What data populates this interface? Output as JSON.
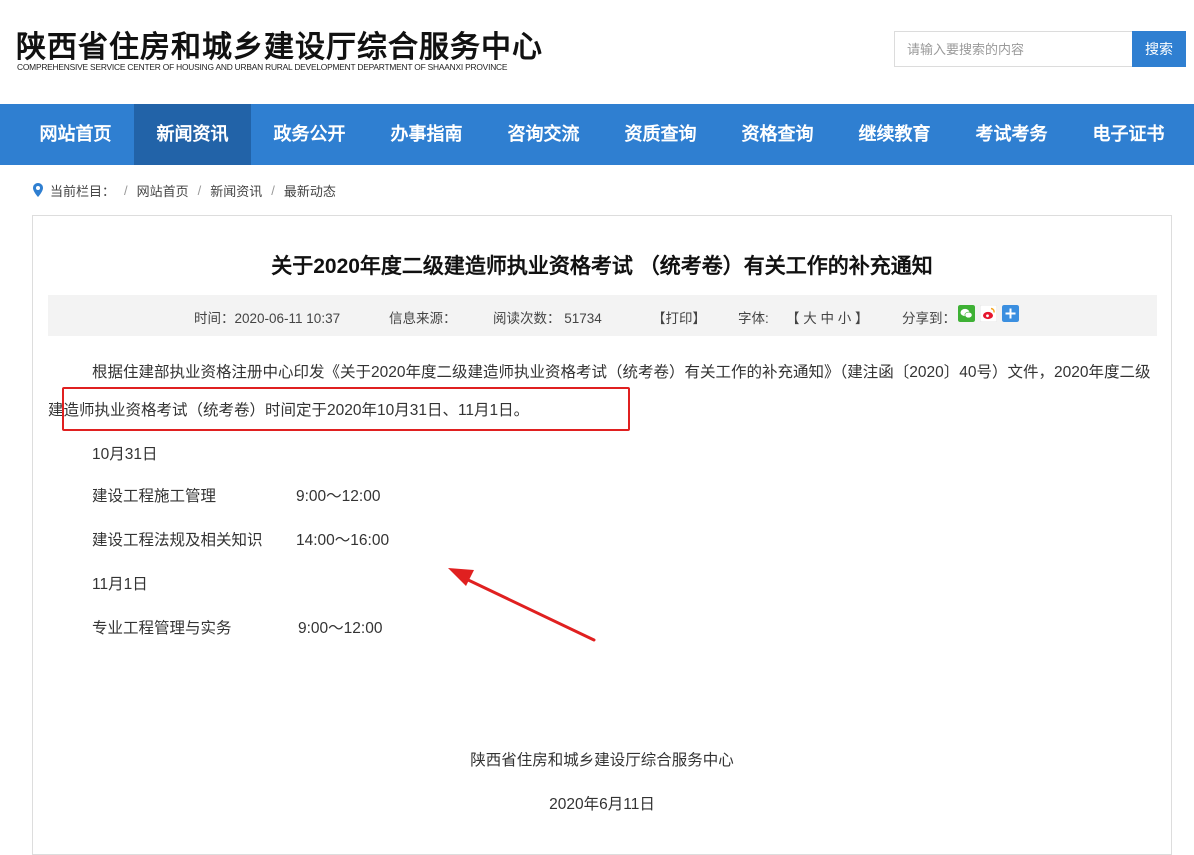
{
  "header": {
    "logo_cn": "陕西省住房和城乡建设厅综合服务中心",
    "logo_en": "COMPREHENSIVE SERVICE CENTER OF HOUSING AND URBAN RURAL DEVELOPMENT DEPARTMENT OF SHAANXI PROVINCE",
    "search_placeholder": "请输入要搜索的内容",
    "search_button": "搜索"
  },
  "nav": {
    "items": [
      "网站首页",
      "新闻资讯",
      "政务公开",
      "办事指南",
      "咨询交流",
      "资质查询",
      "资格查询",
      "继续教育",
      "考试考务",
      "电子证书"
    ],
    "active": "新闻资讯"
  },
  "breadcrumb": {
    "label": "当前栏目：",
    "sep": "/",
    "items": [
      "网站首页",
      "新闻资讯",
      "最新动态"
    ]
  },
  "article": {
    "title": "关于2020年度二级建造师执业资格考试 （统考卷）有关工作的补充通知",
    "meta": {
      "time": "时间：2020-06-11 10:37",
      "source": "信息来源：",
      "reads": "阅读次数： 51734",
      "print": "【打印】",
      "font_label": "字体:",
      "font_sizes": "【 大  中  小 】",
      "share_label": "分享到：",
      "share_icons": [
        "wechat-icon",
        "weibo-icon",
        "more-share-icon"
      ]
    },
    "paragraph": "根据住建部执业资格注册中心印发《关于2020年度二级建造师执业资格考试（统考卷）有关工作的补充通知》（建注函〔2020〕40号）文件，2020年度二级建造师执业资格考试（统考卷）时间定于2020年10月31日、11月1日。",
    "schedule": {
      "day1": "10月31日",
      "day1_items": [
        {
          "subject": "建设工程施工管理",
          "time": "9:00～12:00"
        },
        {
          "subject": "建设工程法规及相关知识",
          "time": "14:00～16:00"
        }
      ],
      "day2": "11月1日",
      "day2_items": [
        {
          "subject": "专业工程管理与实务",
          "time": "9:00～12:00"
        }
      ]
    },
    "signature": "陕西省住房和城乡建设厅综合服务中心",
    "date": "2020年6月11日"
  },
  "colors": {
    "nav_bg": "#2f7fd1",
    "nav_active": "#2263a8",
    "annotation_red": "#e02020"
  }
}
